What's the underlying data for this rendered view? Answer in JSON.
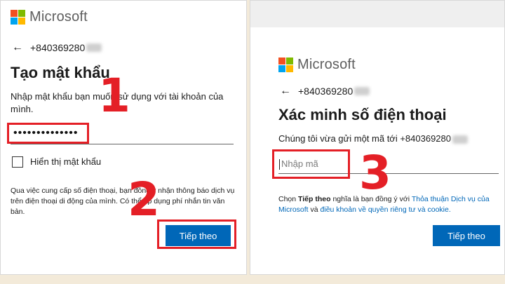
{
  "brand": {
    "name": "Microsoft",
    "colors": [
      "#f25022",
      "#7fba00",
      "#00a4ef",
      "#ffb900"
    ]
  },
  "left": {
    "phone": "+840369280",
    "title": "Tạo mật khẩu",
    "description": "Nhập mật khẩu bạn muốn sử dụng với tài khoản của mình.",
    "password_value": "••••••••••••••",
    "show_password_label": "Hiển thị mật khẩu",
    "notice": "Qua việc cung cấp số điện thoại, bạn đồng ý nhận thông báo dịch vụ trên điện thoại di động của mình. Có thể áp dụng phí nhắn tin văn bản.",
    "next_button": "Tiếp theo"
  },
  "right": {
    "phone": "+840369280",
    "title": "Xác minh số điện thoại",
    "description": "Chúng tôi vừa gửi một mã tới +840369280",
    "code_placeholder": "Nhập mã",
    "terms_prefix": "Chọn",
    "terms_bold": "Tiếp theo",
    "terms_middle": "nghĩa là bạn đồng ý với",
    "terms_link1": "Thỏa thuận Dịch vụ của Microsoft",
    "terms_and": "và",
    "terms_link2": "điều khoản về quyền riêng tư và cookie.",
    "next_button": "Tiếp theo"
  },
  "steps": [
    "1",
    "2",
    "3"
  ],
  "accent": {
    "button": "#0067b8",
    "highlight": "#e41f26"
  }
}
